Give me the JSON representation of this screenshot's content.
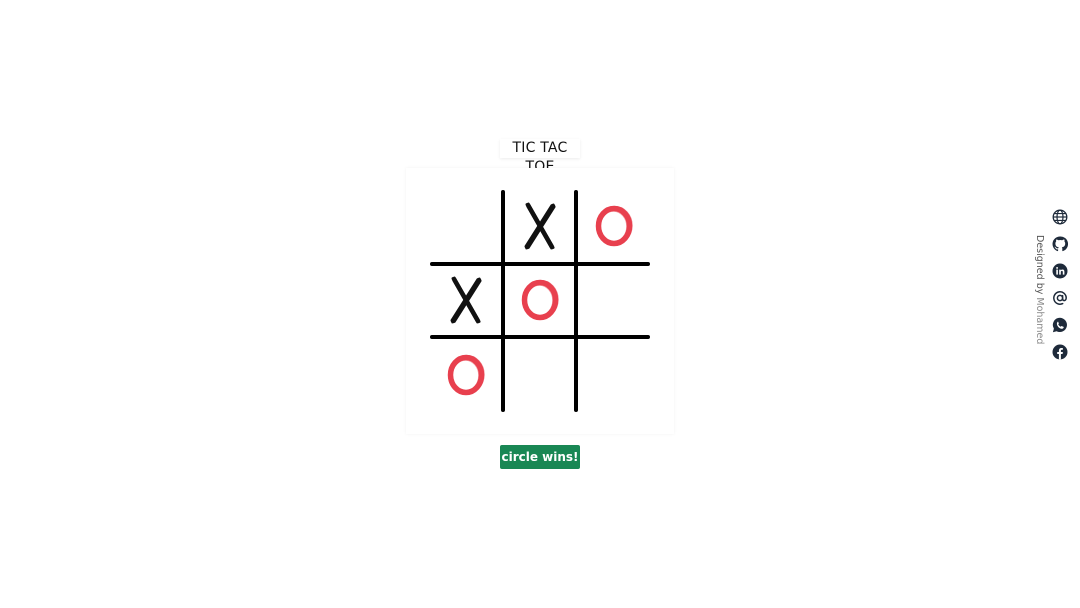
{
  "game": {
    "title": "TIC TAC TOE",
    "board": [
      [
        "",
        "X",
        "O"
      ],
      [
        "X",
        "O",
        ""
      ],
      [
        "O",
        "",
        ""
      ]
    ],
    "status": "circle wins!"
  },
  "footer": {
    "designed_by_prefix": "Designed by",
    "designed_by_name": "Mohamed"
  },
  "social_links": [
    {
      "icon": "globe-icon"
    },
    {
      "icon": "github-icon"
    },
    {
      "icon": "linkedin-icon"
    },
    {
      "icon": "email-at-icon"
    },
    {
      "icon": "whatsapp-icon"
    },
    {
      "icon": "facebook-icon"
    }
  ],
  "colors": {
    "x_mark": "#111111",
    "o_mark": "#e8404e",
    "grid": "#000000",
    "status_bg": "#198754",
    "icon": "#1e2a3a"
  }
}
